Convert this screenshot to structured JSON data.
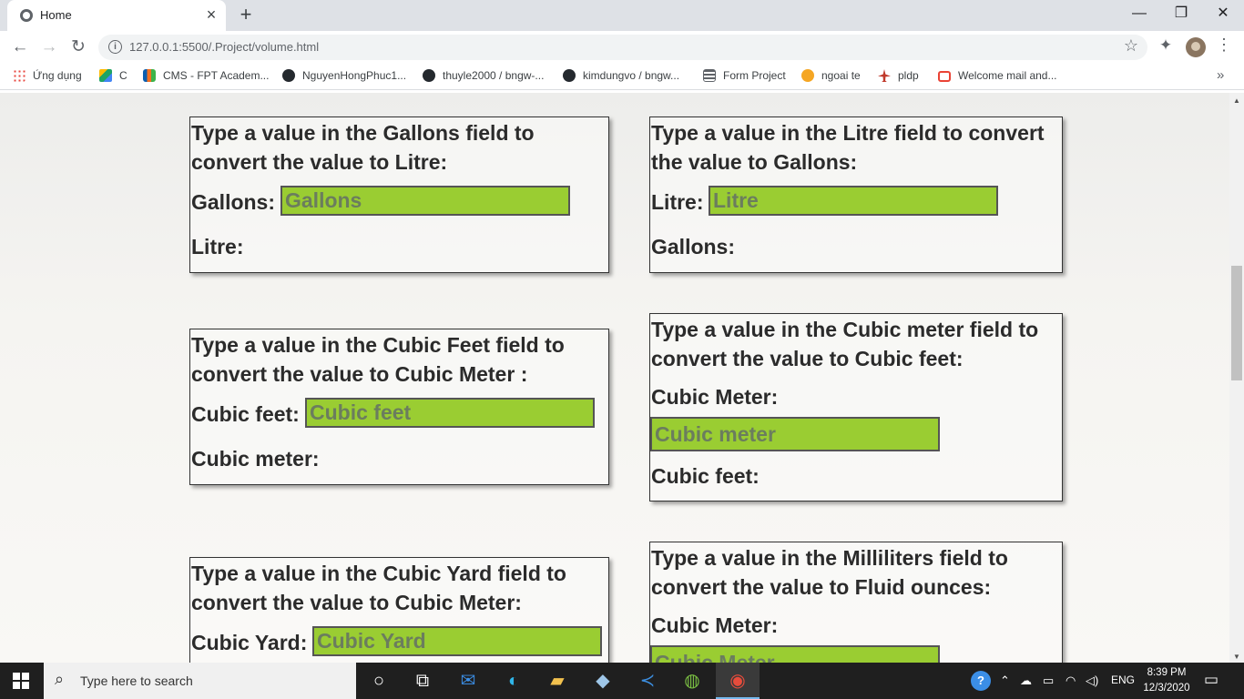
{
  "browser": {
    "tab_title": "Home",
    "url": "127.0.0.1:5500/.Project/volume.html",
    "bookmarks": [
      {
        "label": "Ứng dụng",
        "icon": "apps-grid-icon",
        "color": "#e8453c"
      },
      {
        "label": "C",
        "icon": "google-drive-icon",
        "color": "#1fa463"
      },
      {
        "label": "CMS - FPT Academ...",
        "icon": "fpt-icon",
        "color": "#f26f21"
      },
      {
        "label": "NguyenHongPhuc1...",
        "icon": "github-icon",
        "color": "#24292e"
      },
      {
        "label": "thuyle2000 / bngw-...",
        "icon": "github-icon",
        "color": "#24292e"
      },
      {
        "label": "kimdungvo / bngw...",
        "icon": "github-icon",
        "color": "#24292e"
      },
      {
        "label": "Form Project",
        "icon": "form-icon",
        "color": "#5f6368"
      },
      {
        "label": "ngoai te",
        "icon": "currency-icon",
        "color": "#f5a623"
      },
      {
        "label": "pldp",
        "icon": "airplane-icon",
        "color": "#c0392b"
      },
      {
        "label": "Welcome mail and...",
        "icon": "gmail-icon",
        "color": "#ea4335"
      }
    ]
  },
  "converters": {
    "gallons_to_litre": {
      "instruction": "Type a value in the Gallons field to convert the value to Litre:",
      "input_label": "Gallons:",
      "placeholder": "Gallons",
      "output_label": "Litre:"
    },
    "litre_to_gallons": {
      "instruction": "Type a value in the Litre field to convert the value to Gallons:",
      "input_label": "Litre:",
      "placeholder": "Litre",
      "output_label": "Gallons:"
    },
    "cubicfeet_to_cubicmeter": {
      "instruction": "Type a value in the Cubic Feet field to convert the value to Cubic Meter :",
      "input_label": "Cubic feet:",
      "placeholder": "Cubic feet",
      "output_label": "Cubic meter:"
    },
    "cubicmeter_to_cubicfeet": {
      "instruction": "Type a value in the Cubic meter field to convert the value to Cubic feet:",
      "input_label": "Cubic Meter:",
      "placeholder": "Cubic meter",
      "output_label": "Cubic feet:"
    },
    "cubicyard_to_cubicmeter": {
      "instruction": "Type a value in the Cubic Yard field to convert the value to Cubic Meter:",
      "input_label": "Cubic Yard:",
      "placeholder": "Cubic Yard"
    },
    "milliliters_to_fluidounces": {
      "instruction": "Type a value in the Milliliters field to convert the value to Fluid ounces:",
      "input_label": "Cubic Meter:",
      "placeholder": "Cubic Meter"
    }
  },
  "colors": {
    "field_green": "#9acd32",
    "text": "#2b2b2b"
  },
  "taskbar": {
    "search_placeholder": "Type here to search",
    "language": "ENG",
    "time": "8:39 PM",
    "date": "12/3/2020"
  }
}
